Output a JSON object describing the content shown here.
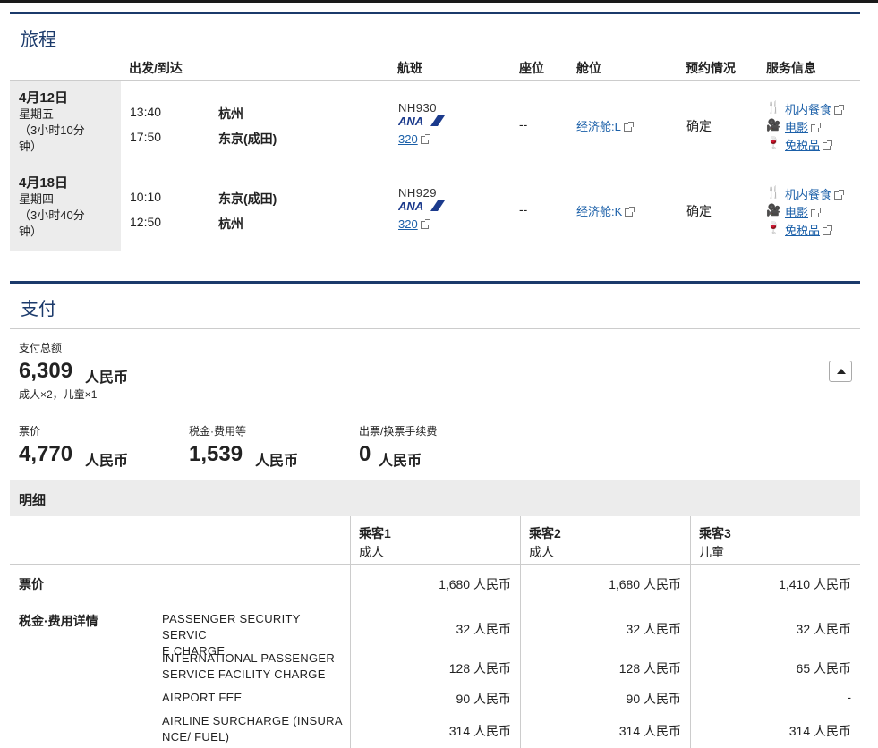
{
  "itinerary": {
    "title": "旅程",
    "headers": {
      "depart_arrive": "出发/到达",
      "flight": "航班",
      "seat": "座位",
      "cabin": "舱位",
      "booking": "预约情况",
      "service": "服务信息"
    },
    "rows": [
      {
        "date": "4月12日",
        "weekday": "星期五",
        "duration1": "（3小时10分",
        "duration2": "钟）",
        "dep_time": "13:40",
        "dep_city": "杭州",
        "arr_time": "17:50",
        "arr_city": "东京(成田)",
        "flight_no": "NH930",
        "aircraft": "320",
        "seat": "--",
        "cabin": "经济舱:L",
        "status": "确定",
        "services": [
          "机内餐食",
          "电影",
          "免税品"
        ]
      },
      {
        "date": "4月18日",
        "weekday": "星期四",
        "duration1": "（3小时40分",
        "duration2": "钟）",
        "dep_time": "10:10",
        "dep_city": "东京(成田)",
        "arr_time": "12:50",
        "arr_city": "杭州",
        "flight_no": "NH929",
        "aircraft": "320",
        "seat": "--",
        "cabin": "经济舱:K",
        "status": "确定",
        "services": [
          "机内餐食",
          "电影",
          "免税品"
        ]
      }
    ],
    "airline_logo": "ANA"
  },
  "payment": {
    "title": "支付",
    "total_label": "支付总额",
    "total_amount": "6,309",
    "currency": "人民币",
    "pax_summary": "成人×2，儿童×1",
    "fare_label": "票价",
    "fare_amount": "4,770",
    "tax_label": "税金·费用等",
    "tax_amount": "1,539",
    "fee_label": "出票/换票手续费",
    "fee_amount": "0",
    "detail_title": "明细",
    "passengers": [
      {
        "name": "乘客1",
        "type": "成人"
      },
      {
        "name": "乘客2",
        "type": "成人"
      },
      {
        "name": "乘客3",
        "type": "儿童"
      }
    ],
    "fare_row_label": "票价",
    "fare_values": [
      "1,680 人民币",
      "1,680 人民币",
      "1,410 人民币"
    ],
    "tax_row_label": "税金·费用详情",
    "tax_items": [
      {
        "name1": "PASSENGER SECURITY SERVIC",
        "name2": "E CHARGE",
        "values": [
          "32 人民币",
          "32 人民币",
          "32 人民币"
        ]
      },
      {
        "name1": "INTERNATIONAL PASSENGER",
        "name2": "SERVICE FACILITY CHARGE",
        "values": [
          "128 人民币",
          "128 人民币",
          "65 人民币"
        ]
      },
      {
        "name1": "AIRPORT FEE",
        "name2": "",
        "values": [
          "90 人民币",
          "90 人民币",
          "-"
        ]
      },
      {
        "name1": "AIRLINE SURCHARGE (INSURA",
        "name2": "NCE/ FUEL)",
        "values": [
          "314 人民币",
          "314 人民币",
          "314 人民币"
        ]
      }
    ]
  },
  "colors": {
    "accent": "#1b3a6b",
    "link": "#1a5fa8",
    "ana_blue": "#1b3a8c"
  }
}
